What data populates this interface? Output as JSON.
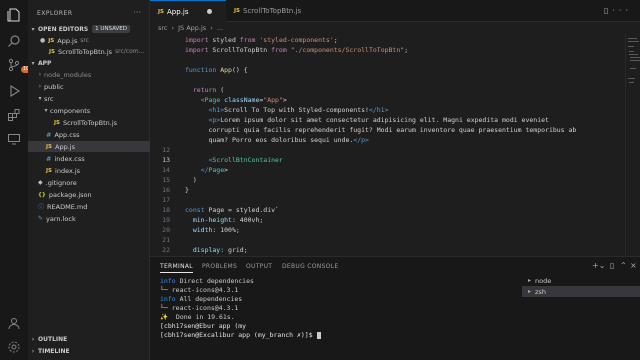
{
  "sidebar": {
    "title": "EXPLORER",
    "open_editors": {
      "label": "OPEN EDITORS",
      "badge": "1 UNSAVED",
      "items": [
        {
          "name": "App.js",
          "path": "src"
        },
        {
          "name": "ScrollToTopBtn.js",
          "path": "src/com..."
        }
      ]
    },
    "project": {
      "label": "APP",
      "tree": [
        {
          "name": "node_modules",
          "kind": "folder"
        },
        {
          "name": "public",
          "kind": "folder"
        },
        {
          "name": "src",
          "kind": "folder-open"
        },
        {
          "name": "components",
          "kind": "folder-open"
        },
        {
          "name": "ScrollToTopBtn.js",
          "kind": "js"
        },
        {
          "name": "App.css",
          "kind": "css"
        },
        {
          "name": "App.js",
          "kind": "js"
        },
        {
          "name": "index.css",
          "kind": "css"
        },
        {
          "name": "index.js",
          "kind": "js"
        },
        {
          "name": ".gitignore",
          "kind": "file"
        },
        {
          "name": "package.json",
          "kind": "json"
        },
        {
          "name": "README.md",
          "kind": "md"
        },
        {
          "name": "yarn.lock",
          "kind": "lock"
        }
      ]
    },
    "outline_label": "OUTLINE",
    "timeline_label": "TIMELINE",
    "activity_badge": "10K"
  },
  "tabs": [
    {
      "label": "App.js",
      "active": true
    },
    {
      "label": "ScrollToTopBtn.js",
      "active": false
    }
  ],
  "breadcrumb": [
    "src",
    "JS App.js",
    "..."
  ],
  "editor": {
    "lines": [
      {
        "n": "",
        "text": "import styled from 'styled-components';"
      },
      {
        "n": "",
        "text": "import ScrollToTopBtn from \"./components/ScrollToTopBtn\";"
      },
      {
        "n": "",
        "text": ""
      },
      {
        "n": "",
        "text": "function App() {"
      },
      {
        "n": "",
        "text": ""
      },
      {
        "n": "",
        "text": "  return ("
      },
      {
        "n": "",
        "text": "    <Page className=\"App\">"
      },
      {
        "n": "",
        "text": "      <h1>Scroll To Top with Styled-components!</h1>"
      },
      {
        "n": "",
        "text": "      <p>Lorem ipsum dolor sit amet consectetur adipisicing elit. Magni expedita modi eveniet"
      },
      {
        "n": "",
        "text": "      corrupti quia facilis reprehenderit fugit? Modi earum inventore quae praesentium temporibus ab"
      },
      {
        "n": "",
        "text": "      quam? Porro eos doloribus sequi unde.</p>"
      },
      {
        "n": "12",
        "text": ""
      },
      {
        "n": "13",
        "text": "      <ScrollBtnContainer"
      },
      {
        "n": "14",
        "text": "    </Page>"
      },
      {
        "n": "15",
        "text": "  )"
      },
      {
        "n": "16",
        "text": "}"
      },
      {
        "n": "17",
        "text": ""
      },
      {
        "n": "18",
        "text": "const Page = styled.div`"
      },
      {
        "n": "19",
        "text": "  min-height: 400vh;"
      },
      {
        "n": "20",
        "text": "  width: 100%;"
      },
      {
        "n": "21",
        "text": ""
      },
      {
        "n": "22",
        "text": "  display: grid;"
      }
    ]
  },
  "panel": {
    "tabs": [
      "TERMINAL",
      "PROBLEMS",
      "OUTPUT",
      "DEBUG CONSOLE"
    ],
    "terminal_lines": [
      {
        "prefix": "info",
        "text": " Direct dependencies"
      },
      {
        "prefix": "",
        "text": "└─ react-icons@4.3.1"
      },
      {
        "prefix": "info",
        "text": " All dependencies"
      },
      {
        "prefix": "",
        "text": "└─ react-icons@4.3.1"
      },
      {
        "prefix": "✨",
        "text": "  Done in 19.61s."
      },
      {
        "prompt": "[cbh17sen@Ebur app (my"
      },
      {
        "prompt": "[cbh17sen@Excalibur app (my_branch ✗)]$ "
      }
    ],
    "terminal_list": [
      "node",
      "zsh"
    ]
  }
}
